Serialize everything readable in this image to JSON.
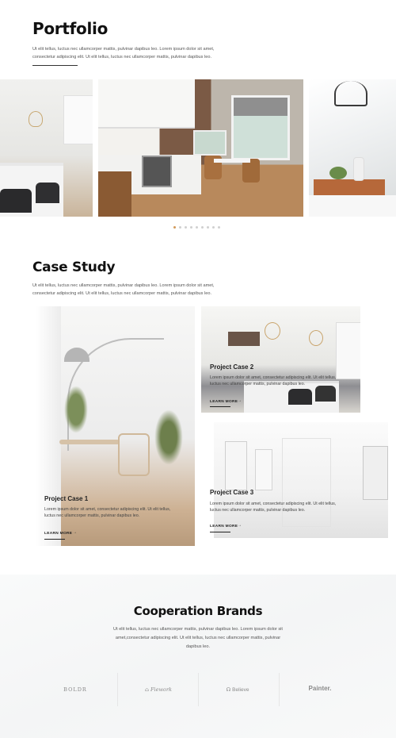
{
  "portfolio": {
    "title": "Portfolio",
    "description_line1": "Ut elit tellus, luctus nec ullamcorper mattis, pulvinar dapibus leo. Lorem ipsum dolor sit amet,",
    "description_line2": "consectetur adipiscing elit. Ut elit tellus, luctus nec ullamcorper mattis, pulvinar dapibus leo.",
    "slider": {
      "slide_count": 9,
      "active_index": 0
    },
    "colors": {
      "active_dot": "#d39a5a",
      "inactive_dot": "#d0d0d0"
    }
  },
  "case_study": {
    "title": "Case Study",
    "description_line1": "Ut elit tellus, luctus nec ullamcorper mattis, pulvinar dapibus leo. Lorem ipsum dolor sit amet,",
    "description_line2": "consectetur adipiscing elit. Ut elit tellus, luctus nec ullamcorper mattis, pulvinar dapibus leo.",
    "cases": [
      {
        "title": "Project Case 1",
        "desc_line1": "Lorem ipsum dolor sit amet, consectetur adipiscing elit. Ut elit tellus,",
        "desc_line2": "luctus nec ullamcorper mattis, pulvinar dapibus leo.",
        "link": "LEARN MORE"
      },
      {
        "title": "Project Case 2",
        "desc_line1": "Lorem ipsum dolor sit amet, consectetur adipiscing elit. Ut elit tellus,",
        "desc_line2": "luctus nec ullamcorper mattis, pulvinar dapibus leo.",
        "link": "LEARN MORE"
      },
      {
        "title": "Project Case 3",
        "desc_line1": "Lorem ipsum dolor sit amet, consectetur adipiscing elit. Ut elit tellus,",
        "desc_line2": "luctus nec ullamcorper mattis, pulvinar dapibus leo.",
        "link": "LEARN MORE"
      }
    ],
    "arrow_icon": "arrow-right-icon"
  },
  "brands": {
    "title": "Cooperation Brands",
    "description_line1": "Ut elit tellus, luctus nec ullamcorper mattis, pulvinar dapibus leo. Lorem ipsum dolor sit",
    "description_line2": "amet,consectetur adipiscing elit. Ut elit tellus, luctus nec ullamcorper mattis, pulvinar",
    "description_line3": "dapibus leo.",
    "logos": [
      "BOLDR",
      "Fiework",
      "Believe",
      "Painter."
    ],
    "logo_icons": [
      "",
      "house-icon",
      "headphones-icon",
      ""
    ]
  }
}
